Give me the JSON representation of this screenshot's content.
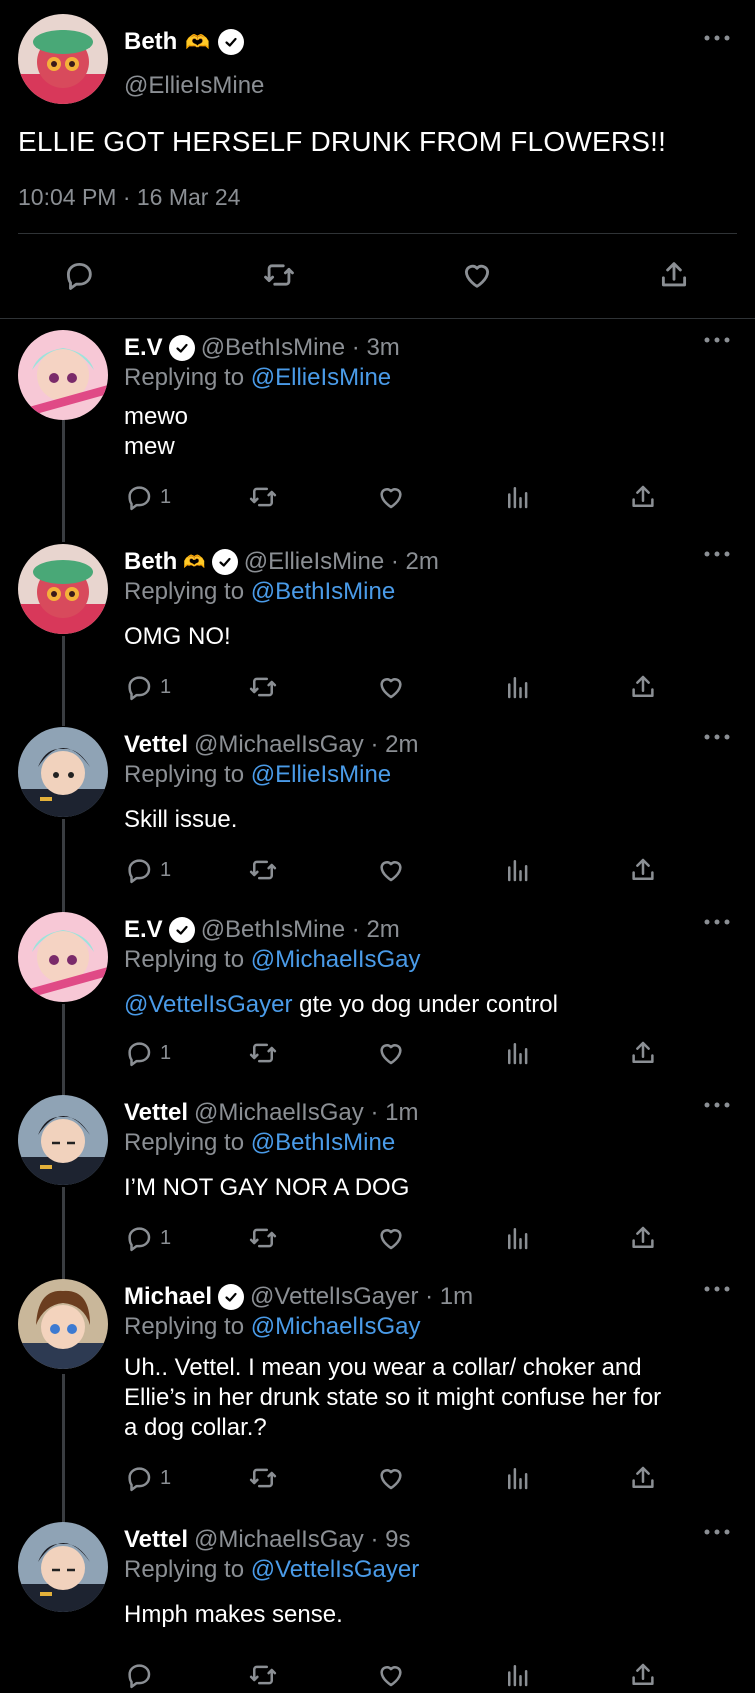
{
  "main_tweet": {
    "name": "Beth",
    "handle": "@EllieIsMine",
    "text": "ELLIE GOT HERSELF DRUNK FROM FLOWERS!!",
    "timestamp": "10:04 PM · 16 Mar 24",
    "verified": true,
    "emoji": "🫶"
  },
  "replies": [
    {
      "name": "E.V",
      "verified": true,
      "handle": "@BethIsMine",
      "time": "· 3m",
      "replying_prefix": "Replying to ",
      "replying_to": "@EllieIsMine",
      "lines": [
        "mewo",
        "mew"
      ],
      "mention": "",
      "text": "",
      "reply_count": "1"
    },
    {
      "name": "Beth",
      "verified": true,
      "emoji": "🫶",
      "handle": "@EllieIsMine",
      "time": "· 2m",
      "replying_prefix": "Replying to ",
      "replying_to": "@BethIsMine",
      "lines": [
        "OMG NO!"
      ],
      "mention": "",
      "text": "",
      "reply_count": "1"
    },
    {
      "name": "Vettel",
      "verified": false,
      "handle": "@MichaelIsGay",
      "time": "· 2m",
      "replying_prefix": "Replying to ",
      "replying_to": "@EllieIsMine",
      "lines": [
        "Skill issue."
      ],
      "mention": "",
      "text": "",
      "reply_count": "1"
    },
    {
      "name": "E.V",
      "verified": true,
      "handle": "@BethIsMine",
      "time": "· 2m",
      "replying_prefix": "Replying to ",
      "replying_to": "@MichaelIsGay",
      "lines": [],
      "mention": "@VettelIsGayer",
      "text": " gte yo dog under control",
      "reply_count": "1"
    },
    {
      "name": "Vettel",
      "verified": false,
      "handle": "@MichaelIsGay",
      "time": "· 1m",
      "replying_prefix": "Replying to ",
      "replying_to": "@BethIsMine",
      "lines": [
        "I’M NOT GAY NOR A DOG"
      ],
      "mention": "",
      "text": "",
      "reply_count": "1"
    },
    {
      "name": "Michael",
      "verified": true,
      "handle": "@VettelIsGayer",
      "time": "· 1m",
      "replying_prefix": "Replying to ",
      "replying_to": "@MichaelIsGay",
      "lines": [
        "Uh.. Vettel. I mean you wear a collar/ choker and",
        "Ellie’s in her drunk state so it might confuse her for",
        "a dog collar.?"
      ],
      "mention": "",
      "text": "",
      "reply_count": "1"
    },
    {
      "name": "Vettel",
      "verified": false,
      "handle": "@MichaelIsGay",
      "time": "· 9s",
      "replying_prefix": "Replying to ",
      "replying_to": "@VettelIsGayer",
      "lines": [
        "Hmph makes sense."
      ],
      "mention": "",
      "text": "",
      "reply_count": ""
    }
  ],
  "icons": {
    "reply": "reply-icon",
    "retweet": "retweet-icon",
    "like": "heart-icon",
    "views": "views-icon",
    "share": "share-icon",
    "more": "more-icon",
    "verified": "verified-badge-icon"
  },
  "colors": {
    "background": "#000000",
    "link": "#4a9be8",
    "muted": "#8b8f94",
    "divider": "#2f3336"
  }
}
